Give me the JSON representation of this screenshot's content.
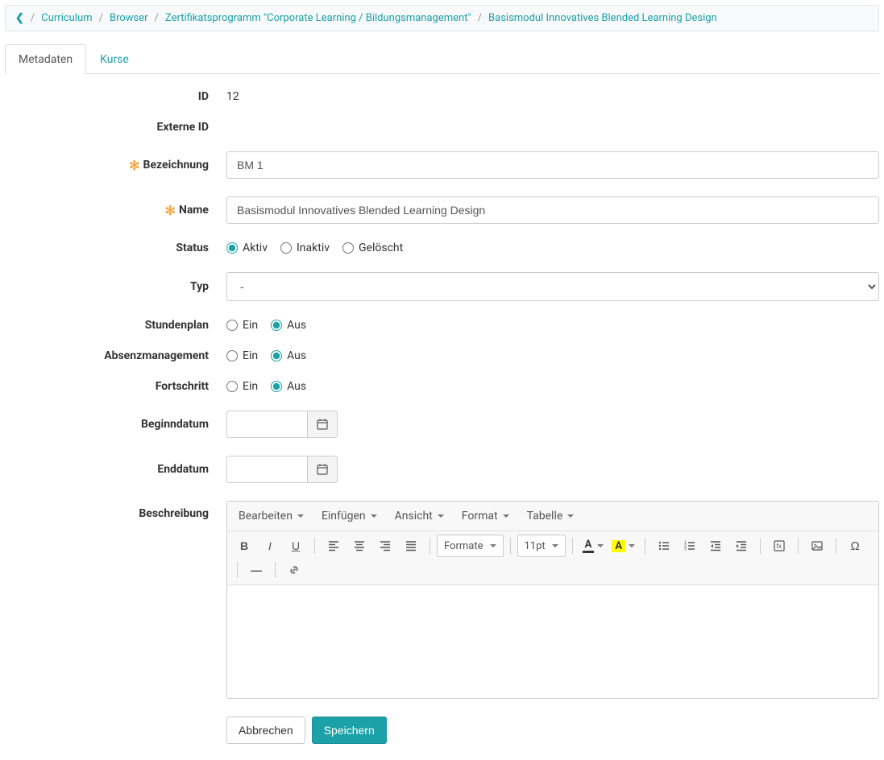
{
  "breadcrumb": {
    "items": [
      "Curriculum",
      "Browser",
      "Zertifikatsprogramm \"Corporate Learning / Bildungsmanagement\"",
      "Basismodul Innovatives Blended Learning Design"
    ]
  },
  "tabs": [
    {
      "label": "Metadaten",
      "active": true
    },
    {
      "label": "Kurse",
      "active": false
    }
  ],
  "form": {
    "id_label": "ID",
    "id_value": "12",
    "external_id_label": "Externe ID",
    "external_id_value": "",
    "identifier_label": "Bezeichnung",
    "identifier_value": "BM 1",
    "name_label": "Name",
    "name_value": "Basismodul Innovatives Blended Learning Design",
    "status_label": "Status",
    "status_options": {
      "active": "Aktiv",
      "inactive": "Inaktiv",
      "deleted": "Gelöscht"
    },
    "type_label": "Typ",
    "type_value": "-",
    "schedule_label": "Stundenplan",
    "absence_label": "Absenzmanagement",
    "progress_label": "Fortschritt",
    "onoff": {
      "on": "Ein",
      "off": "Aus"
    },
    "begin_label": "Beginndatum",
    "begin_value": "",
    "end_label": "Enddatum",
    "end_value": "",
    "description_label": "Beschreibung"
  },
  "editor": {
    "menubar": {
      "edit": "Bearbeiten",
      "insert": "Einfügen",
      "view": "Ansicht",
      "format": "Format",
      "table": "Tabelle"
    },
    "toolbar": {
      "formats": "Formate",
      "fontsize": "11pt"
    }
  },
  "buttons": {
    "cancel": "Abbrechen",
    "save": "Speichern"
  }
}
